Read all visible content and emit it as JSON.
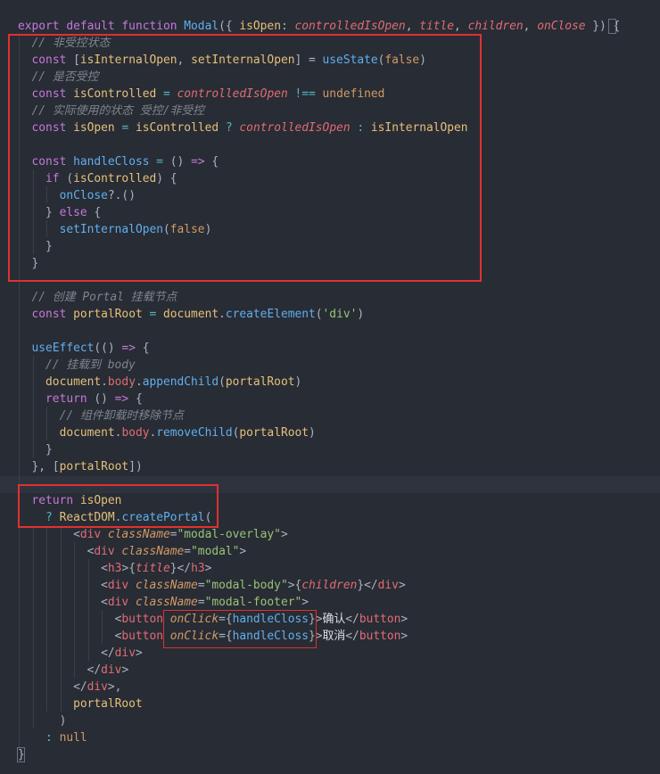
{
  "editor": {
    "lines": [
      [
        [
          "kw",
          "export "
        ],
        [
          "kw",
          "default "
        ],
        [
          "kw",
          "function "
        ],
        [
          "fn",
          "Modal"
        ],
        [
          "punc",
          "({ "
        ],
        [
          "param_plain",
          "isOpen"
        ],
        [
          "punc",
          ": "
        ],
        [
          "param",
          "controlledIsOpen"
        ],
        [
          "punc",
          ", "
        ],
        [
          "param",
          "title"
        ],
        [
          "punc",
          ", "
        ],
        [
          "param",
          "children"
        ],
        [
          "punc",
          ", "
        ],
        [
          "param",
          "onClose"
        ],
        [
          "punc",
          " }) {"
        ]
      ],
      [
        [
          "plain",
          "  "
        ],
        [
          "com",
          "// 非受控状态"
        ]
      ],
      [
        [
          "plain",
          "  "
        ],
        [
          "kw",
          "const "
        ],
        [
          "punc",
          "["
        ],
        [
          "var",
          "isInternalOpen"
        ],
        [
          "punc",
          ", "
        ],
        [
          "var",
          "setInternalOpen"
        ],
        [
          "punc",
          "] = "
        ],
        [
          "fn",
          "useState"
        ],
        [
          "punc",
          "("
        ],
        [
          "const",
          "false"
        ],
        [
          "punc",
          ")"
        ]
      ],
      [
        [
          "plain",
          "  "
        ],
        [
          "com",
          "// 是否受控"
        ]
      ],
      [
        [
          "plain",
          "  "
        ],
        [
          "kw",
          "const "
        ],
        [
          "var",
          "isControlled"
        ],
        [
          "op",
          " = "
        ],
        [
          "param",
          "controlledIsOpen"
        ],
        [
          "op",
          " !== "
        ],
        [
          "const",
          "undefined"
        ]
      ],
      [
        [
          "plain",
          "  "
        ],
        [
          "com",
          "// 实际使用的状态 受控/非受控"
        ]
      ],
      [
        [
          "plain",
          "  "
        ],
        [
          "kw",
          "const "
        ],
        [
          "var",
          "isOpen"
        ],
        [
          "op",
          " = "
        ],
        [
          "var",
          "isControlled"
        ],
        [
          "op",
          " ? "
        ],
        [
          "param",
          "controlledIsOpen"
        ],
        [
          "op",
          " : "
        ],
        [
          "var",
          "isInternalOpen"
        ]
      ],
      [],
      [
        [
          "plain",
          "  "
        ],
        [
          "kw",
          "const "
        ],
        [
          "fn",
          "handleCloss"
        ],
        [
          "op",
          " = "
        ],
        [
          "punc",
          "() "
        ],
        [
          "kw",
          "=> "
        ],
        [
          "punc",
          "{"
        ]
      ],
      [
        [
          "plain",
          "    "
        ],
        [
          "kw",
          "if "
        ],
        [
          "punc",
          "("
        ],
        [
          "var",
          "isControlled"
        ],
        [
          "punc",
          ") {"
        ]
      ],
      [
        [
          "plain",
          "      "
        ],
        [
          "fn",
          "onClose"
        ],
        [
          "punc",
          "?.()"
        ]
      ],
      [
        [
          "plain",
          "    "
        ],
        [
          "punc",
          "} "
        ],
        [
          "kw",
          "else "
        ],
        [
          "punc",
          "{"
        ]
      ],
      [
        [
          "plain",
          "      "
        ],
        [
          "fn",
          "setInternalOpen"
        ],
        [
          "punc",
          "("
        ],
        [
          "const",
          "false"
        ],
        [
          "punc",
          ")"
        ]
      ],
      [
        [
          "plain",
          "    "
        ],
        [
          "punc",
          "}"
        ]
      ],
      [
        [
          "plain",
          "  "
        ],
        [
          "punc",
          "}"
        ]
      ],
      [],
      [
        [
          "plain",
          "  "
        ],
        [
          "com",
          "// 创建 Portal 挂载节点"
        ]
      ],
      [
        [
          "plain",
          "  "
        ],
        [
          "kw",
          "const "
        ],
        [
          "var",
          "portalRoot"
        ],
        [
          "op",
          " = "
        ],
        [
          "var",
          "document"
        ],
        [
          "punc",
          "."
        ],
        [
          "fn",
          "createElement"
        ],
        [
          "punc",
          "("
        ],
        [
          "str",
          "'div'"
        ],
        [
          "punc",
          ")"
        ]
      ],
      [],
      [
        [
          "plain",
          "  "
        ],
        [
          "fn",
          "useEffect"
        ],
        [
          "punc",
          "(() "
        ],
        [
          "kw",
          "=> "
        ],
        [
          "punc",
          "{"
        ]
      ],
      [
        [
          "plain",
          "    "
        ],
        [
          "com",
          "// 挂载到 body"
        ]
      ],
      [
        [
          "plain",
          "    "
        ],
        [
          "var",
          "document"
        ],
        [
          "punc",
          "."
        ],
        [
          "tag",
          "body"
        ],
        [
          "punc",
          "."
        ],
        [
          "fn",
          "appendChild"
        ],
        [
          "punc",
          "("
        ],
        [
          "var",
          "portalRoot"
        ],
        [
          "punc",
          ")"
        ]
      ],
      [
        [
          "plain",
          "    "
        ],
        [
          "kw",
          "return "
        ],
        [
          "punc",
          "() "
        ],
        [
          "kw",
          "=> "
        ],
        [
          "punc",
          "{"
        ]
      ],
      [
        [
          "plain",
          "      "
        ],
        [
          "com",
          "// 组件卸载时移除节点"
        ]
      ],
      [
        [
          "plain",
          "      "
        ],
        [
          "var",
          "document"
        ],
        [
          "punc",
          "."
        ],
        [
          "tag",
          "body"
        ],
        [
          "punc",
          "."
        ],
        [
          "fn",
          "removeChild"
        ],
        [
          "punc",
          "("
        ],
        [
          "var",
          "portalRoot"
        ],
        [
          "punc",
          ")"
        ]
      ],
      [
        [
          "plain",
          "    "
        ],
        [
          "punc",
          "}"
        ]
      ],
      [
        [
          "plain",
          "  "
        ],
        [
          "punc",
          "}, ["
        ],
        [
          "var",
          "portalRoot"
        ],
        [
          "punc",
          "])"
        ]
      ],
      [],
      [
        [
          "plain",
          "  "
        ],
        [
          "kw",
          "return "
        ],
        [
          "var",
          "isOpen"
        ]
      ],
      [
        [
          "plain",
          "    "
        ],
        [
          "op",
          "? "
        ],
        [
          "var",
          "ReactDOM"
        ],
        [
          "punc",
          "."
        ],
        [
          "fn",
          "createPortal"
        ],
        [
          "punc",
          "("
        ]
      ],
      [
        [
          "plain",
          "        "
        ],
        [
          "punc",
          "<"
        ],
        [
          "tag",
          "div "
        ],
        [
          "attr",
          "className"
        ],
        [
          "punc",
          "="
        ],
        [
          "str",
          "\"modal-overlay\""
        ],
        [
          "punc",
          ">"
        ]
      ],
      [
        [
          "plain",
          "          "
        ],
        [
          "punc",
          "<"
        ],
        [
          "tag",
          "div "
        ],
        [
          "attr",
          "className"
        ],
        [
          "punc",
          "="
        ],
        [
          "str",
          "\"modal\""
        ],
        [
          "punc",
          ">"
        ]
      ],
      [
        [
          "plain",
          "            "
        ],
        [
          "punc",
          "<"
        ],
        [
          "tag",
          "h3"
        ],
        [
          "punc",
          ">{"
        ],
        [
          "param",
          "title"
        ],
        [
          "punc",
          "}</"
        ],
        [
          "tag",
          "h3"
        ],
        [
          "punc",
          ">"
        ]
      ],
      [
        [
          "plain",
          "            "
        ],
        [
          "punc",
          "<"
        ],
        [
          "tag",
          "div "
        ],
        [
          "attr",
          "className"
        ],
        [
          "punc",
          "="
        ],
        [
          "str",
          "\"modal-body\""
        ],
        [
          "punc",
          ">{"
        ],
        [
          "param",
          "children"
        ],
        [
          "punc",
          "}</"
        ],
        [
          "tag",
          "div"
        ],
        [
          "punc",
          ">"
        ]
      ],
      [
        [
          "plain",
          "            "
        ],
        [
          "punc",
          "<"
        ],
        [
          "tag",
          "div "
        ],
        [
          "attr",
          "className"
        ],
        [
          "punc",
          "="
        ],
        [
          "str",
          "\"modal-footer\""
        ],
        [
          "punc",
          ">"
        ]
      ],
      [
        [
          "plain",
          "              "
        ],
        [
          "punc",
          "<"
        ],
        [
          "tag",
          "button "
        ],
        [
          "attr",
          "onClick"
        ],
        [
          "punc",
          "={"
        ],
        [
          "fn",
          "handleCloss"
        ],
        [
          "punc",
          "}>"
        ],
        [
          "cjk",
          "确认"
        ],
        [
          "punc",
          "</"
        ],
        [
          "tag",
          "button"
        ],
        [
          "punc",
          ">"
        ]
      ],
      [
        [
          "plain",
          "              "
        ],
        [
          "punc",
          "<"
        ],
        [
          "tag",
          "button "
        ],
        [
          "attr",
          "onClick"
        ],
        [
          "punc",
          "={"
        ],
        [
          "fn",
          "handleCloss"
        ],
        [
          "punc",
          "}>"
        ],
        [
          "cjk",
          "取消"
        ],
        [
          "punc",
          "</"
        ],
        [
          "tag",
          "button"
        ],
        [
          "punc",
          ">"
        ]
      ],
      [
        [
          "plain",
          "            "
        ],
        [
          "punc",
          "</"
        ],
        [
          "tag",
          "div"
        ],
        [
          "punc",
          ">"
        ]
      ],
      [
        [
          "plain",
          "          "
        ],
        [
          "punc",
          "</"
        ],
        [
          "tag",
          "div"
        ],
        [
          "punc",
          ">"
        ]
      ],
      [
        [
          "plain",
          "        "
        ],
        [
          "punc",
          "</"
        ],
        [
          "tag",
          "div"
        ],
        [
          "punc",
          ">,"
        ]
      ],
      [
        [
          "plain",
          "        "
        ],
        [
          "var",
          "portalRoot"
        ]
      ],
      [
        [
          "plain",
          "      "
        ],
        [
          "punc",
          ")"
        ]
      ],
      [
        [
          "plain",
          "    "
        ],
        [
          "op",
          ": "
        ],
        [
          "const",
          "null"
        ]
      ],
      [
        [
          "punc",
          "}"
        ]
      ]
    ],
    "highlighted_line": 27,
    "annotation_colors": {
      "background": "#282c34",
      "highlight": "#e03131"
    }
  }
}
